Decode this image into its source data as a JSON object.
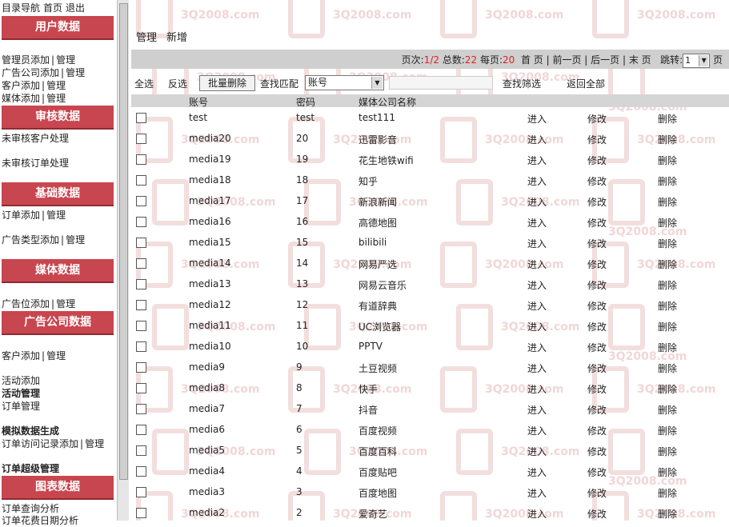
{
  "sidebar": {
    "top_links": [
      "目录导航",
      "首页",
      "退出"
    ],
    "sections": [
      {
        "title": "用户数据"
      },
      {
        "title": "审核数据"
      },
      {
        "title": "基础数据"
      },
      {
        "title": "媒体数据"
      },
      {
        "title": "广告公司数据"
      },
      {
        "title": "图表数据"
      }
    ],
    "links": {
      "admin_add": "管理员添加",
      "admin_manage": "管理",
      "adco_add": "广告公司添加",
      "adco_manage": "管理",
      "client_add": "客户添加",
      "client_manage": "管理",
      "media_add": "媒体添加",
      "media_manage": "管理",
      "unreviewed_client": "未审核客户处理",
      "unreviewed_order": "未审核订单处理",
      "order_add": "订单添加",
      "order_manage": "管理",
      "adtype_add": "广告类型添加",
      "adtype_manage": "管理",
      "adslot_add": "广告位添加",
      "adslot_manage": "管理",
      "client2_add": "客户添加",
      "client2_manage": "管理",
      "activity_add": "活动添加",
      "activity_manage": "活动管理",
      "order_manage2": "订单管理",
      "mock_data": "模拟数据生成",
      "visit_add": "订单访问记录添加",
      "visit_manage": "管理",
      "order_super": "订单超级管理",
      "order_query": "订单查询分析",
      "order_cost": "订单花费日期分析"
    }
  },
  "main": {
    "tabs": [
      "管理",
      "新增"
    ],
    "pager": {
      "page_label": "页次:",
      "page_value": "1/2",
      "total_label": "总数:",
      "total_value": "22",
      "per_label": "每页:",
      "per_value": "20",
      "first": "首 页",
      "prev": "前一页",
      "next": "后一页",
      "last": "末 页",
      "jump_label": "跳转:",
      "jump_value": "1",
      "page_suffix": "页"
    },
    "toolbar": {
      "select_all": "全选",
      "invert": "反选",
      "batch_delete": "批量删除",
      "match_label": "查找匹配",
      "match_field": "账号",
      "search_filter": "查找筛选",
      "return_all": "返回全部"
    },
    "columns": {
      "account": "账号",
      "password": "密码",
      "media_company": "媒体公司名称"
    },
    "row_actions": {
      "enter": "进入",
      "edit": "修改",
      "delete": "删除"
    },
    "rows": [
      {
        "account": "test",
        "password": "test",
        "name": "test111"
      },
      {
        "account": "media20",
        "password": "20",
        "name": "迅雷影音"
      },
      {
        "account": "media19",
        "password": "19",
        "name": "花生地铁wifi"
      },
      {
        "account": "media18",
        "password": "18",
        "name": "知乎"
      },
      {
        "account": "media17",
        "password": "17",
        "name": "新浪新闻"
      },
      {
        "account": "media16",
        "password": "16",
        "name": "高德地图"
      },
      {
        "account": "media15",
        "password": "15",
        "name": "bilibili"
      },
      {
        "account": "media14",
        "password": "14",
        "name": "网易严选"
      },
      {
        "account": "media13",
        "password": "13",
        "name": "网易云音乐"
      },
      {
        "account": "media12",
        "password": "12",
        "name": "有道辞典"
      },
      {
        "account": "media11",
        "password": "11",
        "name": "UC浏览器"
      },
      {
        "account": "media10",
        "password": "10",
        "name": "PPTV"
      },
      {
        "account": "media9",
        "password": "9",
        "name": "土豆视频"
      },
      {
        "account": "media8",
        "password": "8",
        "name": "快手"
      },
      {
        "account": "media7",
        "password": "7",
        "name": "抖音"
      },
      {
        "account": "media6",
        "password": "6",
        "name": "百度视频"
      },
      {
        "account": "media5",
        "password": "5",
        "name": "百度百科"
      },
      {
        "account": "media4",
        "password": "4",
        "name": "百度贴吧"
      },
      {
        "account": "media3",
        "password": "3",
        "name": "百度地图"
      },
      {
        "account": "media2",
        "password": "2",
        "name": "爱奇艺"
      }
    ]
  },
  "watermark": {
    "text": "3Q2008.com"
  }
}
